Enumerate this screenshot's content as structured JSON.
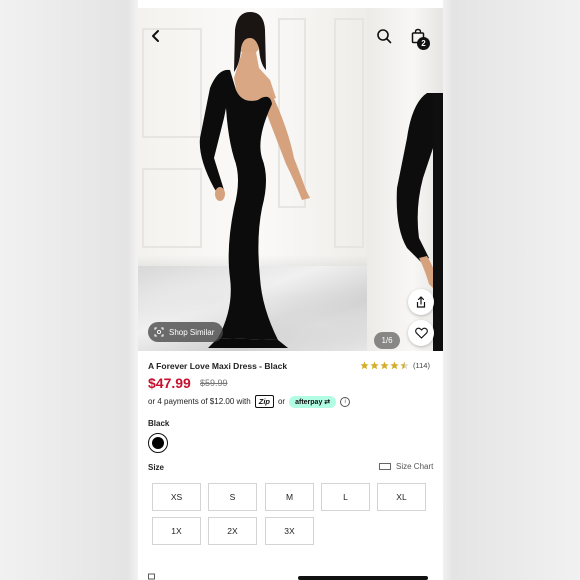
{
  "header": {
    "back_icon": "back-arrow-icon",
    "search_icon": "search-icon",
    "bag_icon": "shopping-bag-icon",
    "bag_count": "2"
  },
  "gallery": {
    "shop_similar_label": "Shop Similar",
    "pager": "1/6",
    "share_icon": "share-icon",
    "favorite_icon": "heart-icon"
  },
  "product": {
    "title": "A Forever Love Maxi Dress - Black",
    "rating": 4.5,
    "rating_count": "(114)",
    "price_sale": "$47.99",
    "price_original": "$59.99",
    "payments_prefix": "or 4 payments of $12.00 with",
    "payments_zip": "Zip",
    "payments_or": "or",
    "payments_afterpay": "afterpay",
    "color_label": "Black",
    "size_label": "Size",
    "size_chart_label": "Size Chart",
    "sizes": [
      "XS",
      "S",
      "M",
      "L",
      "XL",
      "1X",
      "2X",
      "3X"
    ]
  },
  "colors": {
    "sale_price": "#c8102e",
    "afterpay": "#b2fce4",
    "swatch": "#000000"
  }
}
